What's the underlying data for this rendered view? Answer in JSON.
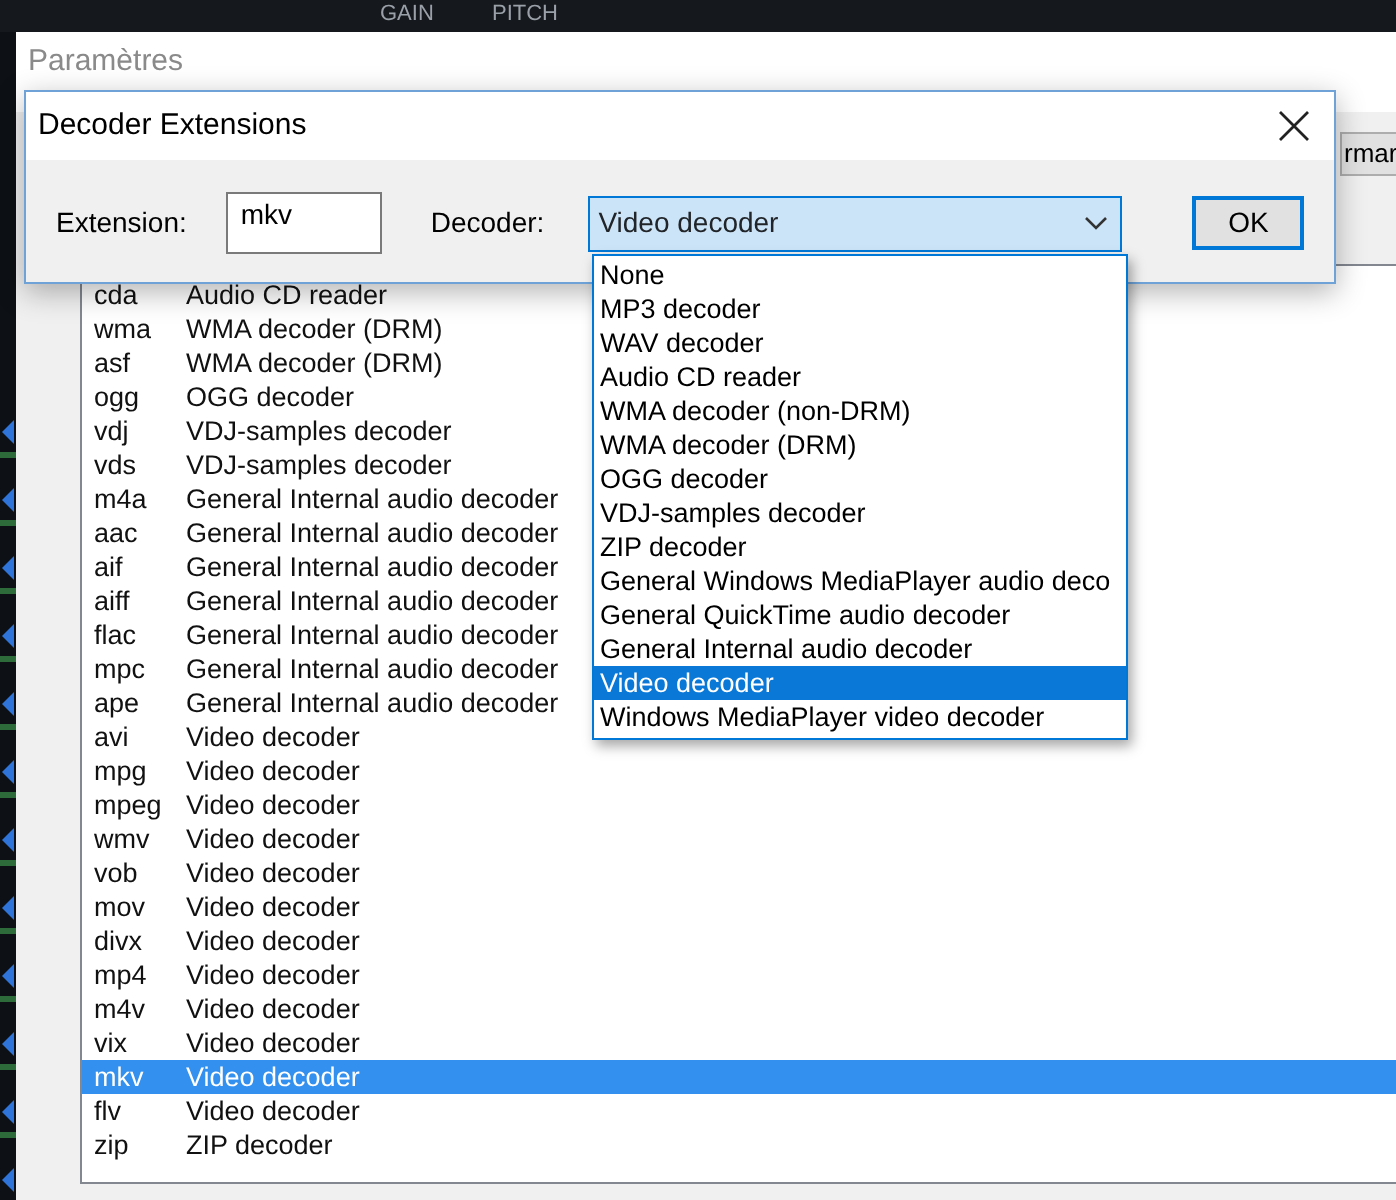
{
  "background_app": {
    "labels": [
      "GAIN",
      "PITCH"
    ]
  },
  "settings_window": {
    "title": "Paramètres",
    "partial_button": "rmar",
    "rows": [
      {
        "extension": "cda",
        "decoder": "Audio CD reader",
        "selected": false
      },
      {
        "extension": "wma",
        "decoder": "WMA decoder (DRM)",
        "selected": false
      },
      {
        "extension": "asf",
        "decoder": "WMA decoder (DRM)",
        "selected": false
      },
      {
        "extension": "ogg",
        "decoder": "OGG decoder",
        "selected": false
      },
      {
        "extension": "vdj",
        "decoder": "VDJ-samples decoder",
        "selected": false
      },
      {
        "extension": "vds",
        "decoder": "VDJ-samples decoder",
        "selected": false
      },
      {
        "extension": "m4a",
        "decoder": "General Internal audio decoder",
        "selected": false
      },
      {
        "extension": "aac",
        "decoder": "General Internal audio decoder",
        "selected": false
      },
      {
        "extension": "aif",
        "decoder": "General Internal audio decoder",
        "selected": false
      },
      {
        "extension": "aiff",
        "decoder": "General Internal audio decoder",
        "selected": false
      },
      {
        "extension": "flac",
        "decoder": "General Internal audio decoder",
        "selected": false
      },
      {
        "extension": "mpc",
        "decoder": "General Internal audio decoder",
        "selected": false
      },
      {
        "extension": "ape",
        "decoder": "General Internal audio decoder",
        "selected": false
      },
      {
        "extension": "avi",
        "decoder": "Video decoder",
        "selected": false
      },
      {
        "extension": "mpg",
        "decoder": "Video decoder",
        "selected": false
      },
      {
        "extension": "mpeg",
        "decoder": "Video decoder",
        "selected": false
      },
      {
        "extension": "wmv",
        "decoder": "Video decoder",
        "selected": false
      },
      {
        "extension": "vob",
        "decoder": "Video decoder",
        "selected": false
      },
      {
        "extension": "mov",
        "decoder": "Video decoder",
        "selected": false
      },
      {
        "extension": "divx",
        "decoder": "Video decoder",
        "selected": false
      },
      {
        "extension": "mp4",
        "decoder": "Video decoder",
        "selected": false
      },
      {
        "extension": "m4v",
        "decoder": "Video decoder",
        "selected": false
      },
      {
        "extension": "vix",
        "decoder": "Video decoder",
        "selected": false
      },
      {
        "extension": "mkv",
        "decoder": "Video decoder",
        "selected": true
      },
      {
        "extension": "flv",
        "decoder": "Video decoder",
        "selected": false
      },
      {
        "extension": "zip",
        "decoder": "ZIP decoder",
        "selected": false
      }
    ]
  },
  "dialog": {
    "title": "Decoder Extensions",
    "extension_label": "Extension:",
    "extension_value": "mkv",
    "decoder_label": "Decoder:",
    "decoder_value": "Video decoder",
    "ok_button": "OK",
    "dropdown_options": [
      {
        "label": "None",
        "selected": false
      },
      {
        "label": "MP3 decoder",
        "selected": false
      },
      {
        "label": "WAV decoder",
        "selected": false
      },
      {
        "label": "Audio CD reader",
        "selected": false
      },
      {
        "label": "WMA decoder (non-DRM)",
        "selected": false
      },
      {
        "label": "WMA decoder (DRM)",
        "selected": false
      },
      {
        "label": "OGG decoder",
        "selected": false
      },
      {
        "label": "VDJ-samples decoder",
        "selected": false
      },
      {
        "label": "ZIP decoder",
        "selected": false
      },
      {
        "label": "General Windows MediaPlayer audio deco",
        "selected": false
      },
      {
        "label": "General QuickTime audio decoder",
        "selected": false
      },
      {
        "label": "General Internal audio decoder",
        "selected": false
      },
      {
        "label": "Video decoder",
        "selected": true
      },
      {
        "label": "Windows MediaPlayer video decoder",
        "selected": false
      }
    ]
  }
}
